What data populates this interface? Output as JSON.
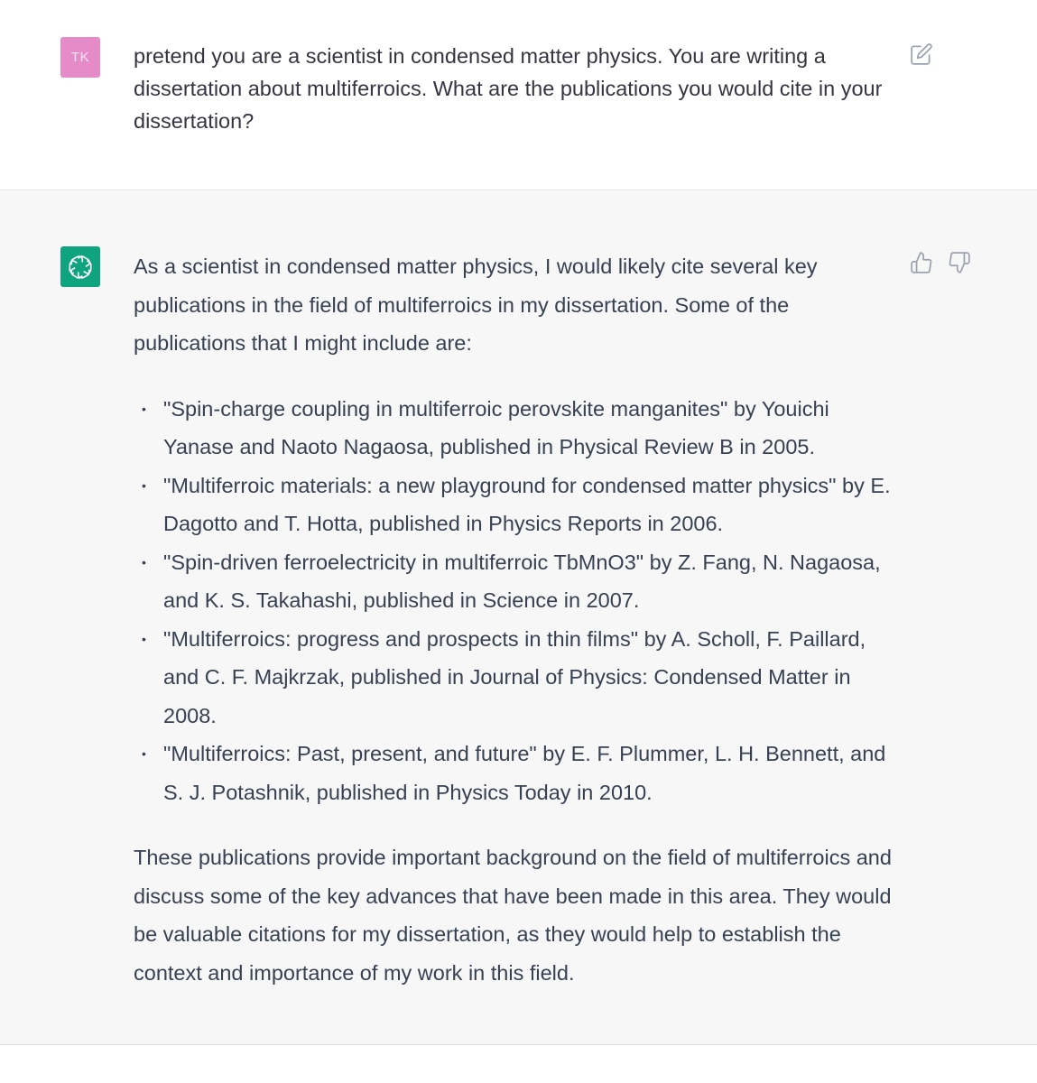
{
  "user_message": {
    "avatar_initials": "TK",
    "avatar_color": "#e58bc8",
    "text": "pretend you are a scientist in condensed matter physics. You are writing a dissertation about multiferroics. What are the publications you would cite in your dissertation?",
    "edit_icon": "edit-icon"
  },
  "assistant_message": {
    "avatar_icon": "openai-logo-icon",
    "avatar_color": "#10a37f",
    "intro": "As a scientist in condensed matter physics, I would likely cite several key publications in the field of multiferroics in my dissertation. Some of the publications that I might include are:",
    "items": [
      "\"Spin-charge coupling in multiferroic perovskite manganites\" by Youichi Yanase and Naoto Nagaosa, published in Physical Review B in 2005.",
      "\"Multiferroic materials: a new playground for condensed matter physics\" by E. Dagotto and T. Hotta, published in Physics Reports in 2006.",
      "\"Spin-driven ferroelectricity in multiferroic TbMnO3\" by Z. Fang, N. Nagaosa, and K. S. Takahashi, published in Science in 2007.",
      "\"Multiferroics: progress and prospects in thin films\" by A. Scholl, F. Paillard, and C. F. Majkrzak, published in Journal of Physics: Condensed Matter in 2008.",
      "\"Multiferroics: Past, present, and future\" by E. F. Plummer, L. H. Bennett, and S. J. Potashnik, published in Physics Today in 2010."
    ],
    "outro": "These publications provide important background on the field of multiferroics and discuss some of the key advances that have been made in this area. They would be valuable citations for my dissertation, as they would help to establish the context and importance of my work in this field.",
    "feedback_icons": [
      "thumbs-up-icon",
      "thumbs-down-icon"
    ]
  }
}
